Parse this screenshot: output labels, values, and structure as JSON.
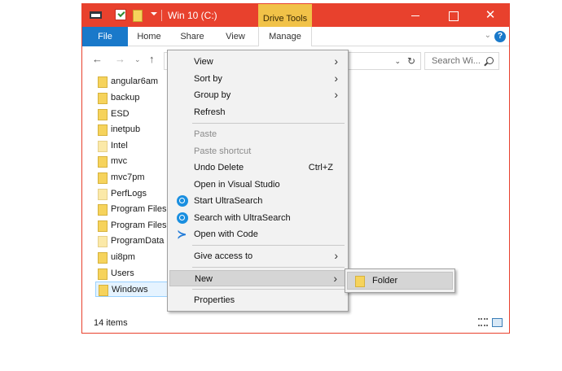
{
  "window": {
    "title": "Win 10 (C:)",
    "context_tab": "Drive Tools",
    "accent_color": "#e8412d",
    "minimize_icon": "minimize-icon",
    "maximize_icon": "maximize-icon",
    "close_glyph": "✕"
  },
  "ribbon": {
    "tabs": [
      "File",
      "Home",
      "Share",
      "View",
      "Manage"
    ],
    "help_glyph": "?",
    "expand_glyph": "⌄"
  },
  "navigation": {
    "back_glyph": "←",
    "forward_glyph": "→",
    "recent_glyph": "⌄",
    "up_glyph": "↑",
    "address_dropdown_glyph": "⌄",
    "refresh_glyph": "↻",
    "search_placeholder": "Search Wi..."
  },
  "files": [
    {
      "name": "angular6am"
    },
    {
      "name": "backup"
    },
    {
      "name": "ESD"
    },
    {
      "name": "inetpub"
    },
    {
      "name": "Intel"
    },
    {
      "name": "mvc"
    },
    {
      "name": "mvc7pm"
    },
    {
      "name": "PerfLogs"
    },
    {
      "name": "Program Files"
    },
    {
      "name": "Program Files"
    },
    {
      "name": "ProgramData"
    },
    {
      "name": "ui8pm"
    },
    {
      "name": "Users"
    },
    {
      "name": "Windows",
      "selected": true
    }
  ],
  "status": {
    "item_count": "14 items"
  },
  "context_menu": {
    "view": "View",
    "sort_by": "Sort by",
    "group_by": "Group by",
    "refresh": "Refresh",
    "paste": "Paste",
    "paste_shortcut": "Paste shortcut",
    "undo_delete": "Undo Delete",
    "undo_shortcut": "Ctrl+Z",
    "open_vs": "Open in Visual Studio",
    "start_ultrasearch": "Start UltraSearch",
    "search_ultrasearch": "Search with UltraSearch",
    "open_code": "Open with Code",
    "give_access": "Give access to",
    "new": "New",
    "properties": "Properties",
    "submenu_arrow": "›"
  },
  "new_submenu": {
    "folder": "Folder"
  }
}
